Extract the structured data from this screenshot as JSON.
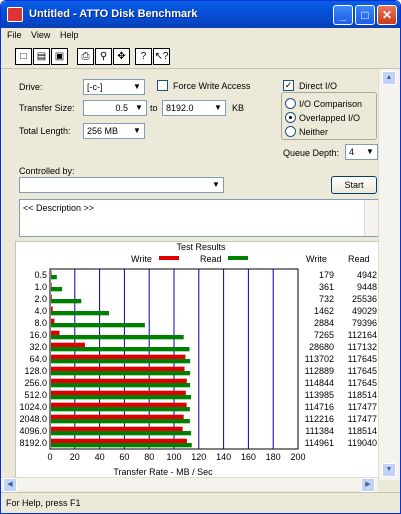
{
  "window": {
    "title": "Untitled - ATTO Disk Benchmark",
    "min": "_",
    "max": "□",
    "close": "✕"
  },
  "menu": {
    "file": "File",
    "view": "View",
    "help": "Help"
  },
  "toolbar": {
    "new": "new-icon",
    "open": "open-icon",
    "save": "save-icon",
    "print": "print-icon",
    "preview": "print-preview-icon",
    "move": "move-icon",
    "about": "help-icon",
    "context": "context-help-icon"
  },
  "form": {
    "drive_label": "Drive:",
    "drive_value": "[-c-]",
    "force_write_label": "Force Write Access",
    "transfer_size_label": "Transfer Size:",
    "transfer_from": "0.5",
    "to_label": "to",
    "transfer_to": "8192.0",
    "kb_label": "KB",
    "total_length_label": "Total Length:",
    "total_length_value": "256 MB",
    "direct_io_label": "Direct I/O",
    "io_comparison_label": "I/O Comparison",
    "overlapped_io_label": "Overlapped I/O",
    "neither_label": "Neither",
    "queue_depth_label": "Queue Depth:",
    "queue_depth_value": "4",
    "controlled_by_label": "Controlled by:",
    "controlled_by_value": "",
    "start_label": "Start",
    "description_text": "<< Description >>"
  },
  "results": {
    "title": "Test Results",
    "write_legend": "Write",
    "read_legend": "Read",
    "write_col": "Write",
    "read_col": "Read",
    "x_label": "Transfer Rate - MB / Sec",
    "write_color": "#e00000",
    "read_color": "#008000"
  },
  "chart_data": {
    "type": "bar",
    "title": "Test Results",
    "xlabel": "Transfer Rate - MB / Sec",
    "xlim": [
      0,
      200
    ],
    "xticks": [
      0,
      20,
      40,
      60,
      80,
      100,
      120,
      140,
      160,
      180,
      200
    ],
    "categories": [
      "0.5",
      "1.0",
      "2.0",
      "4.0",
      "8.0",
      "16.0",
      "32.0",
      "64.0",
      "128.0",
      "256.0",
      "512.0",
      "1024.0",
      "2048.0",
      "4096.0",
      "8192.0"
    ],
    "write_values": [
      "179",
      "361",
      "732",
      "1462",
      "2884",
      "7265",
      "28680",
      "113702",
      "112889",
      "114844",
      "113985",
      "114716",
      "112216",
      "111384",
      "114961"
    ],
    "read_values": [
      "4942",
      "9448",
      "25536",
      "49029",
      "79396",
      "112164",
      "117132",
      "117645",
      "117645",
      "117645",
      "118514",
      "117477",
      "117477",
      "118514",
      "119040"
    ],
    "series": [
      {
        "name": "Write",
        "values": [
          0.17,
          0.34,
          0.7,
          1.4,
          2.8,
          6.9,
          27.4,
          108.4,
          107.7,
          109.5,
          108.7,
          109.4,
          107.0,
          106.2,
          109.6
        ]
      },
      {
        "name": "Read",
        "values": [
          4.7,
          9.0,
          24.4,
          46.8,
          75.7,
          107.0,
          111.7,
          112.2,
          112.2,
          112.2,
          113.0,
          112.0,
          112.0,
          113.0,
          113.5
        ]
      }
    ],
    "grid": true,
    "legend": "top-center"
  },
  "status": {
    "text": "For Help, press F1"
  }
}
